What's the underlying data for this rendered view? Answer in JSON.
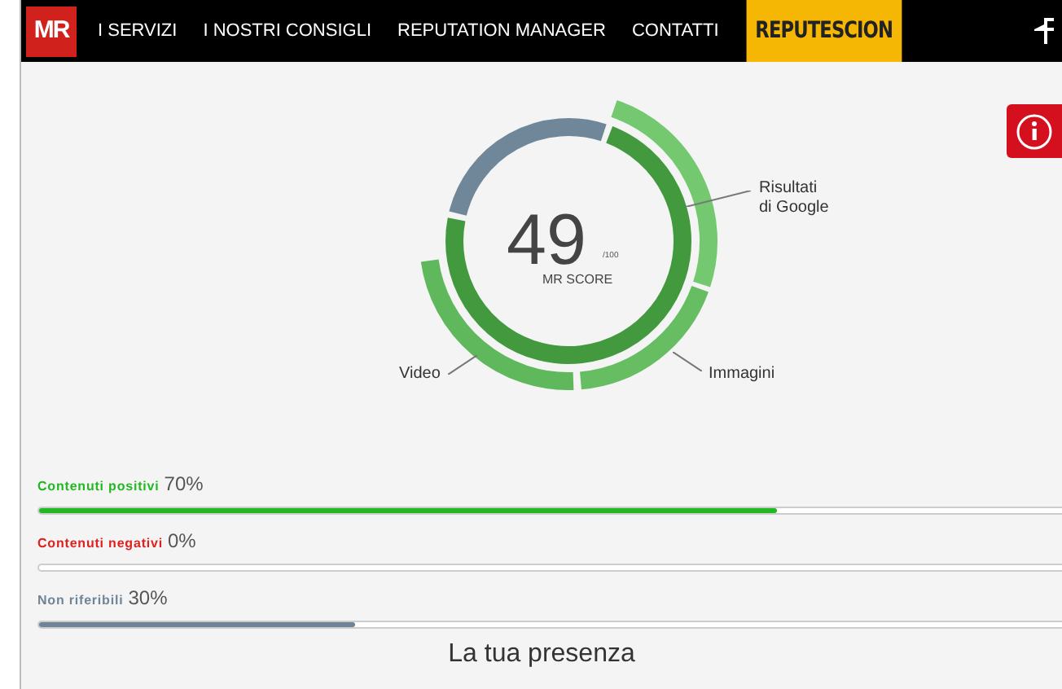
{
  "navbar": {
    "logo": "MR",
    "items": [
      "I SERVIZI",
      "I NOSTRI CONSIGLI",
      "REPUTATION MANAGER",
      "CONTATTI"
    ],
    "brand": "REPUTESCION"
  },
  "score": {
    "value": "49",
    "max": "/100",
    "label": "MR SCORE",
    "segments": [
      "Risultati\ndi Google",
      "Immagini",
      "Video"
    ]
  },
  "bars": [
    {
      "label": "Contenuti positivi",
      "reading": "70%",
      "level": 0.7,
      "color": "#22b822"
    },
    {
      "label": "Contenuti negativi",
      "reading": "0%",
      "level": 0,
      "color": "#e02020"
    },
    {
      "label": "Non riferibili",
      "reading": "30%",
      "level": 0.3,
      "color": "#6f8597"
    }
  ],
  "heading": "La tua presenza"
}
